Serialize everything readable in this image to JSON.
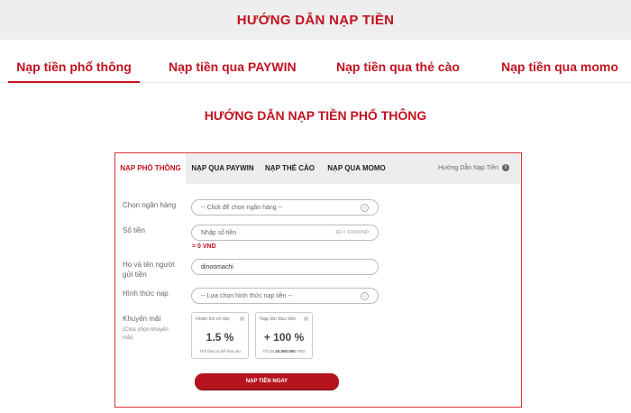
{
  "header": {
    "title": "HƯỚNG DẪN NẠP TIỀN"
  },
  "main_tabs": [
    {
      "label": "Nạp tiền phổ thông"
    },
    {
      "label": "Nạp tiền qua PAYWIN"
    },
    {
      "label": "Nạp tiền qua thẻ cào"
    },
    {
      "label": "Nạp tiền qua momo"
    }
  ],
  "section_title": "HƯỚNG DẪN NẠP TIỀN PHỔ THÔNG",
  "inner_tabs": [
    {
      "label": "NẠP PHỔ THÔNG"
    },
    {
      "label": "NẠP QUA PAYWIN"
    },
    {
      "label": "NẠP THẺ CÀO"
    },
    {
      "label": "NẠP QUA MOMO"
    }
  ],
  "guide_link": "Hướng Dẫn Nạp Tiền",
  "info_icon_glyph": "i",
  "chevron_glyph": "⌄",
  "form": {
    "bank_label": "Chọn ngân hàng",
    "bank_placeholder": "-- Click để chọn ngân hàng --",
    "amount_label": "Số tiền",
    "amount_placeholder": "Nhập số tiền",
    "amount_hint": "1Đ = 1000VND",
    "amount_value": "= 0 VND",
    "name_label_1": "Họ và tên người",
    "name_label_2": "gửi tiền",
    "name_value": "dinoomachi",
    "method_label": "Hình thức nạp",
    "method_placeholder": "-- Lựa chọn hình thức nạp tiền --",
    "promo_label": "Khuyến mãi",
    "promo_sub_1": "(Click chọn khuyến",
    "promo_sub_2": "mãi)",
    "promos": [
      {
        "title": "Hoàn trả vô tận",
        "value": "1.5 %",
        "desc": "Thể thao & thể thao ảo",
        "desc_bold": ""
      },
      {
        "title": "Nạp lần đầu tiên",
        "value": "+ 100 %",
        "desc": "Tối đa ",
        "desc_bold": "20.000.000",
        "desc_tail": " VND"
      }
    ],
    "submit_label": "NẠP TIỀN NGAY"
  },
  "colors": {
    "accent": "#c1121f",
    "frame_border": "#e0313a",
    "topbar_bg": "#eeeeee"
  },
  "icons": [
    "info-icon",
    "chevron-down-icon",
    "radio-icon"
  ]
}
